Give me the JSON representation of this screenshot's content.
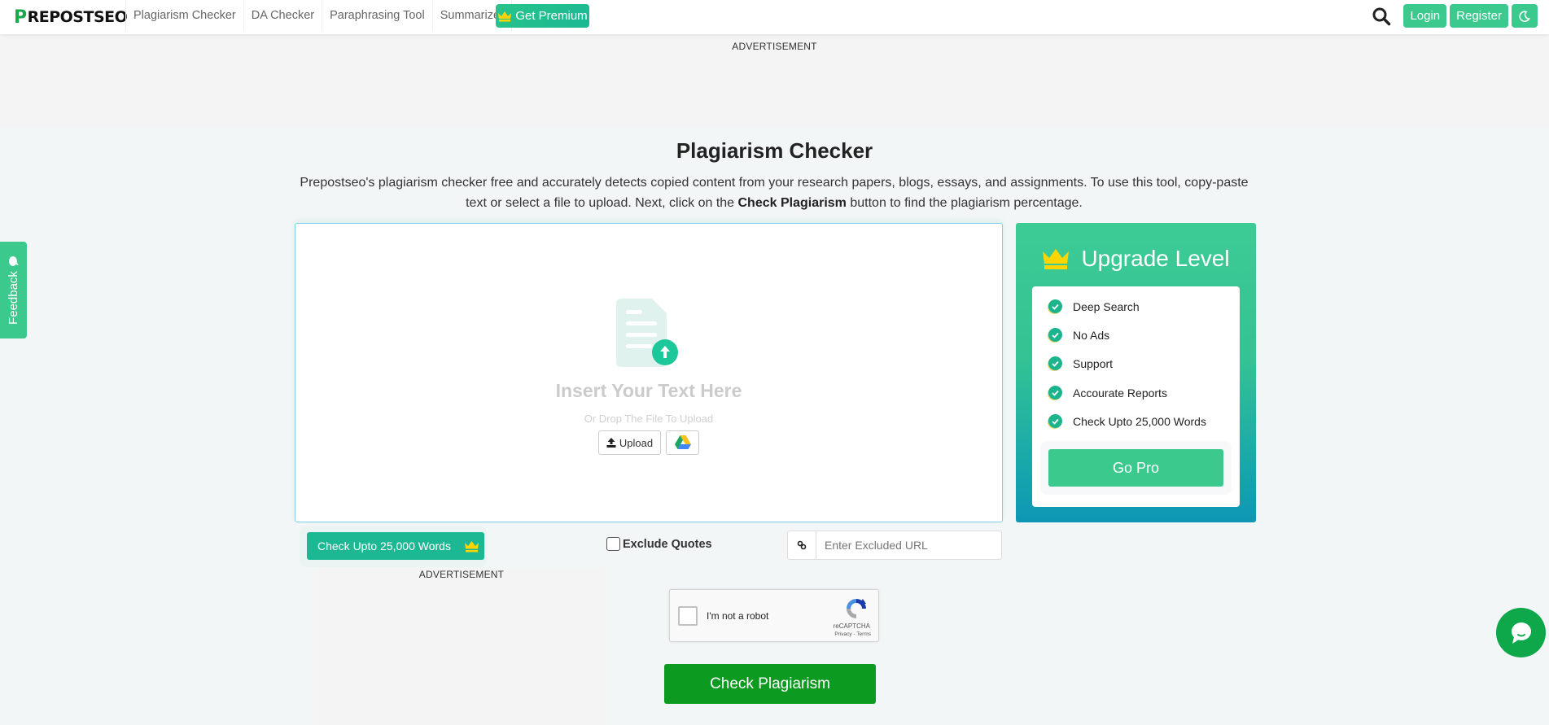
{
  "navbar": {
    "logo_initial": "P",
    "logo_rest": "REPOSTSEO",
    "links": [
      "Plagiarism Checker",
      "DA Checker",
      "Paraphrasing Tool",
      "Summarizer"
    ],
    "premium_label": "Get Premium",
    "login_label": "Login",
    "register_label": "Register"
  },
  "ads": {
    "top_label": "ADVERTISEMENT",
    "bottom_label": "ADVERTISEMENT"
  },
  "feedback": {
    "label": "Feedback"
  },
  "main": {
    "title": "Plagiarism Checker",
    "description_part1": "Prepostseo's plagiarism checker free and accurately detects copied content from your research papers, blogs, essays, and assignments. To use this tool, copy-paste text or select a file to upload. Next, click on the ",
    "description_bold": "Check Plagiarism",
    "description_part2": " button to find the plagiarism percentage."
  },
  "editor": {
    "placeholder_title": "Insert Your Text Here",
    "placeholder_sub": "Or Drop The File To Upload",
    "upload_label": "Upload"
  },
  "upgrade": {
    "title": "Upgrade Level",
    "features": [
      "Deep Search",
      "No Ads",
      "Support",
      "Accourate Reports",
      "Check Upto 25,000 Words"
    ],
    "go_pro_label": "Go Pro"
  },
  "controls": {
    "words_label": "Check Upto 25,000 Words",
    "exclude_quotes_label": "Exclude Quotes",
    "exclude_quotes_checked": false,
    "excluded_url_placeholder": "Enter Excluded URL",
    "excluded_url_value": ""
  },
  "recaptcha": {
    "label": "I'm not a robot",
    "brand": "reCAPTCHA",
    "links": "Privacy - Terms"
  },
  "submit": {
    "label": "Check Plagiarism"
  },
  "colors": {
    "accent": "#3cc98d",
    "accent_dark": "#1cb893",
    "submit_green": "#0c9a20",
    "chat_green": "#0ea74a",
    "crown_yellow": "#ffd500",
    "editor_border": "#7fcde8"
  },
  "icons": {
    "search": "search-icon",
    "moon": "moon-icon",
    "crown": "crown-icon",
    "feedback": "feedback-bubble-icon",
    "document_upload": "document-upload-icon",
    "upload": "upload-icon",
    "google_drive": "google-drive-icon",
    "check": "check-circle-icon",
    "link": "link-icon",
    "recaptcha": "recaptcha-icon",
    "chat": "chat-icon"
  }
}
